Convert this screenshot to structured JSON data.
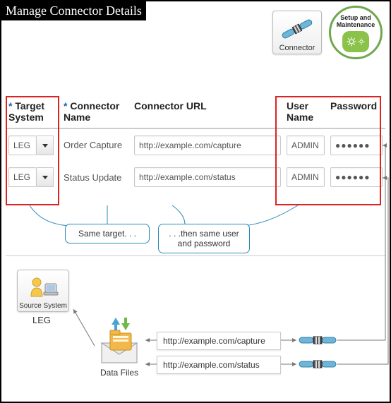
{
  "title": "Manage Connector Details",
  "top_right": {
    "connector_tile_label": "Connector",
    "setup_label_line1": "Setup and",
    "setup_label_line2": "Maintenance"
  },
  "columns": {
    "target": "Target System",
    "name": "Connector Name",
    "url": "Connector URL",
    "user": "User Name",
    "password": "Password"
  },
  "rows": [
    {
      "target": "LEG",
      "name": "Order Capture",
      "url": "http://example.com/capture",
      "user": "ADMIN",
      "password": "●●●●●●"
    },
    {
      "target": "LEG",
      "name": "Status Update",
      "url": "http://example.com/status",
      "user": "ADMIN",
      "password": "●●●●●●"
    }
  ],
  "callouts": {
    "same_target": "Same target. . .",
    "same_user": ". . .then same user and password"
  },
  "bottom": {
    "source_tile_label": "Source System",
    "leg": "LEG",
    "data_files": "Data Files",
    "urls": [
      "http://example.com/capture",
      "http://example.com/status"
    ]
  }
}
